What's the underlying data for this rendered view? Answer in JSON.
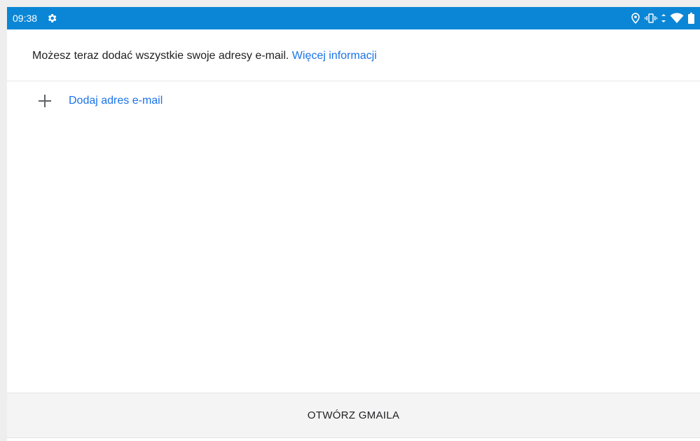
{
  "status_bar": {
    "time": "09:38",
    "background_color": "#0b86d6",
    "icons": [
      "settings-gear-icon",
      "location-icon",
      "vibrate-icon",
      "data-arrows-icon",
      "wifi-icon",
      "battery-icon"
    ]
  },
  "info": {
    "text": "Możesz teraz dodać wszystkie swoje adresy e-mail. ",
    "link": "Więcej informacji"
  },
  "add_email": {
    "label": "Dodaj adres e-mail",
    "icon": "plus-icon"
  },
  "bottom_button": {
    "label": "OTWÓRZ GMAILA"
  },
  "colors": {
    "link": "#1a73e8",
    "text": "#202124"
  }
}
